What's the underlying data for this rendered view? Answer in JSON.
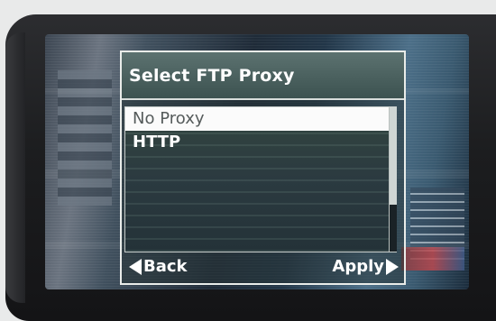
{
  "dialog": {
    "title": "Select FTP Proxy",
    "options": [
      {
        "label": "No Proxy",
        "selected": true
      },
      {
        "label": "HTTP",
        "selected": false
      }
    ],
    "back_label": "Back",
    "apply_label": "Apply"
  },
  "colors": {
    "title_bar": "#4c6260",
    "selected_row": "#fbfbfb",
    "text": "#ffffff"
  },
  "icons": [
    "arrow-left-icon",
    "arrow-right-icon"
  ]
}
